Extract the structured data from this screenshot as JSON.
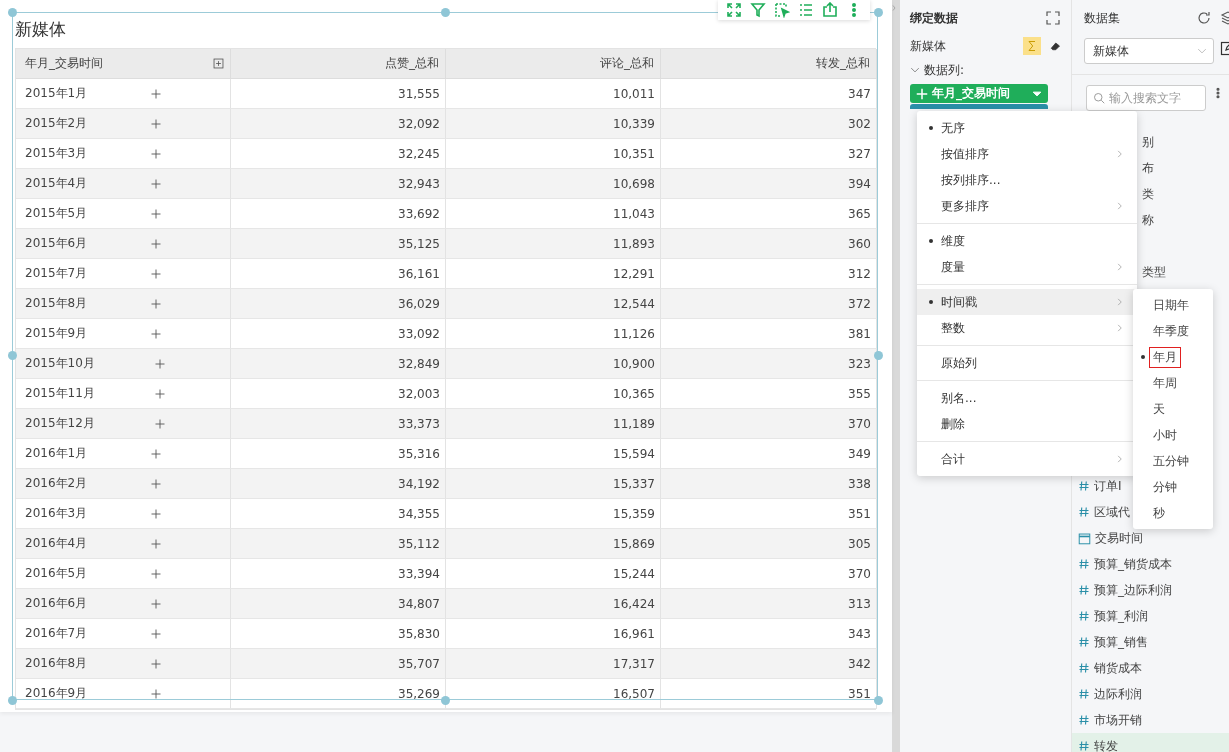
{
  "card": {
    "title": "新媒体"
  },
  "table": {
    "columns": [
      "年月_交易时间",
      "点赞_总和",
      "评论_总和",
      "转发_总和"
    ],
    "rows": [
      {
        "cells": [
          "2015年1月",
          "31,555",
          "10,011",
          "347"
        ]
      },
      {
        "cells": [
          "2015年2月",
          "32,092",
          "10,339",
          "302"
        ]
      },
      {
        "cells": [
          "2015年3月",
          "32,245",
          "10,351",
          "327"
        ]
      },
      {
        "cells": [
          "2015年4月",
          "32,943",
          "10,698",
          "394"
        ]
      },
      {
        "cells": [
          "2015年5月",
          "33,692",
          "11,043",
          "365"
        ]
      },
      {
        "cells": [
          "2015年6月",
          "35,125",
          "11,893",
          "360"
        ]
      },
      {
        "cells": [
          "2015年7月",
          "36,161",
          "12,291",
          "312"
        ]
      },
      {
        "cells": [
          "2015年8月",
          "36,029",
          "12,544",
          "372"
        ]
      },
      {
        "cells": [
          "2015年9月",
          "33,092",
          "11,126",
          "381"
        ]
      },
      {
        "cells": [
          "2015年10月",
          "32,849",
          "10,900",
          "323"
        ]
      },
      {
        "cells": [
          "2015年11月",
          "32,003",
          "10,365",
          "355"
        ]
      },
      {
        "cells": [
          "2015年12月",
          "33,373",
          "11,189",
          "370"
        ]
      },
      {
        "cells": [
          "2016年1月",
          "35,316",
          "15,594",
          "349"
        ]
      },
      {
        "cells": [
          "2016年2月",
          "34,192",
          "15,337",
          "338"
        ]
      },
      {
        "cells": [
          "2016年3月",
          "34,355",
          "15,359",
          "351"
        ]
      },
      {
        "cells": [
          "2016年4月",
          "35,112",
          "15,869",
          "305"
        ]
      },
      {
        "cells": [
          "2016年5月",
          "33,394",
          "15,244",
          "370"
        ]
      },
      {
        "cells": [
          "2016年6月",
          "34,807",
          "16,424",
          "313"
        ]
      },
      {
        "cells": [
          "2016年7月",
          "35,830",
          "16,961",
          "343"
        ]
      },
      {
        "cells": [
          "2016年8月",
          "35,707",
          "17,317",
          "342"
        ]
      },
      {
        "cells": [
          "2016年9月",
          "35,269",
          "16,507",
          "351"
        ]
      }
    ]
  },
  "binding": {
    "title": "绑定数据",
    "dataset": "新媒体",
    "section": {
      "label": "数据列:",
      "expanded": true
    },
    "pill": "年月_交易时间"
  },
  "dataset_panel": {
    "title": "数据集",
    "select": "新媒体",
    "search_placeholder": "输入搜索文字",
    "fields_upper": [
      {
        "name": "别"
      },
      {
        "name": "布"
      },
      {
        "name": "类"
      },
      {
        "name": "称"
      },
      {
        "name": "类型"
      }
    ],
    "fields_lower": [
      {
        "name": "订单I",
        "kind": "measure",
        "selected": false
      },
      {
        "name": "区域代",
        "kind": "measure",
        "selected": false
      },
      {
        "name": "交易时间",
        "kind": "date",
        "selected": false
      },
      {
        "name": "预算_销货成本",
        "kind": "measure",
        "selected": false
      },
      {
        "name": "预算_边际利润",
        "kind": "measure",
        "selected": false
      },
      {
        "name": "预算_利润",
        "kind": "measure",
        "selected": false
      },
      {
        "name": "预算_销售",
        "kind": "measure",
        "selected": false
      },
      {
        "name": "销货成本",
        "kind": "measure",
        "selected": false
      },
      {
        "name": "边际利润",
        "kind": "measure",
        "selected": false
      },
      {
        "name": "市场开销",
        "kind": "measure",
        "selected": false
      },
      {
        "name": "转发",
        "kind": "measure",
        "selected": true
      }
    ]
  },
  "menu": {
    "groups": [
      [
        {
          "label": "无序",
          "checked": true,
          "submenu": false,
          "selected": false
        },
        {
          "label": "按值排序",
          "checked": false,
          "submenu": true,
          "selected": false
        },
        {
          "label": "按列排序...",
          "checked": false,
          "submenu": false,
          "selected": false
        },
        {
          "label": "更多排序",
          "checked": false,
          "submenu": true,
          "selected": false
        }
      ],
      [
        {
          "label": "维度",
          "checked": true,
          "submenu": false,
          "selected": false
        },
        {
          "label": "度量",
          "checked": false,
          "submenu": true,
          "selected": false
        }
      ],
      [
        {
          "label": "时间戳",
          "checked": true,
          "submenu": true,
          "selected": true
        },
        {
          "label": "整数",
          "checked": false,
          "submenu": true,
          "selected": false
        }
      ],
      [
        {
          "label": "原始列",
          "checked": false,
          "submenu": false,
          "selected": false
        }
      ],
      [
        {
          "label": "别名...",
          "checked": false,
          "submenu": false,
          "selected": false
        },
        {
          "label": "删除",
          "checked": false,
          "submenu": false,
          "selected": false
        }
      ],
      [
        {
          "label": "合计",
          "checked": false,
          "submenu": true,
          "selected": false
        }
      ]
    ]
  },
  "submenu": {
    "items": [
      {
        "label": "日期年",
        "checked": false,
        "selected": false
      },
      {
        "label": "年季度",
        "checked": false,
        "selected": false
      },
      {
        "label": "年月",
        "checked": true,
        "selected": true
      },
      {
        "label": "年周",
        "checked": false,
        "selected": false
      },
      {
        "label": "天",
        "checked": false,
        "selected": false
      },
      {
        "label": "小时",
        "checked": false,
        "selected": false
      },
      {
        "label": "五分钟",
        "checked": false,
        "selected": false
      },
      {
        "label": "分钟",
        "checked": false,
        "selected": false
      },
      {
        "label": "秒",
        "checked": false,
        "selected": false
      }
    ]
  }
}
